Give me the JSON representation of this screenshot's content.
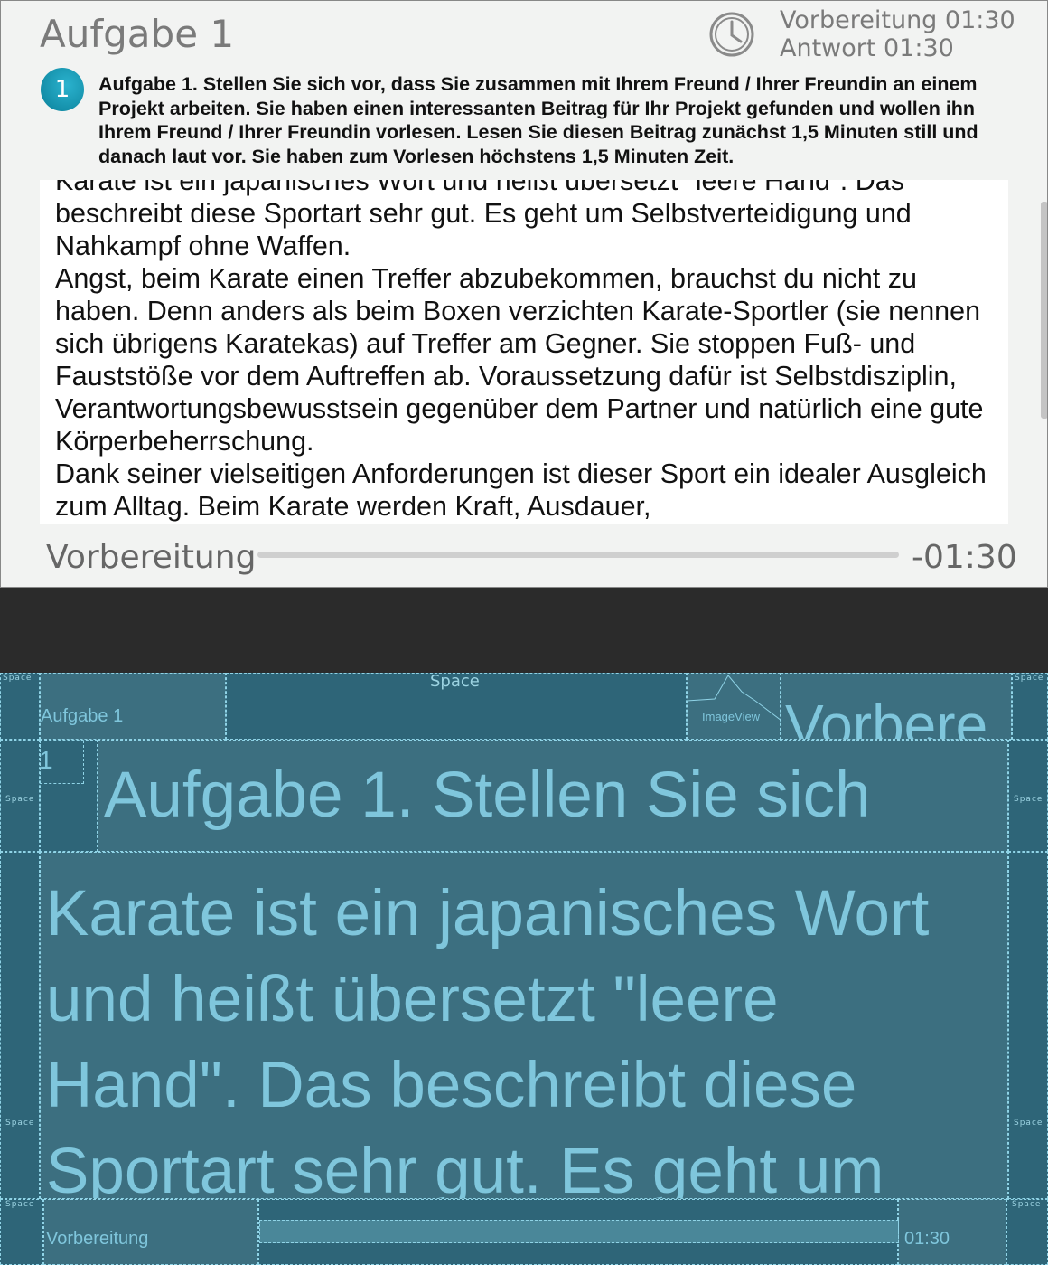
{
  "app": {
    "title": "Aufgabe 1",
    "timers": {
      "preparation": "Vorbereitung 01:30",
      "answer": "Antwort 01:30"
    },
    "badge_number": "1",
    "task_text": "Aufgabe 1. Stellen Sie sich vor, dass Sie zusammen mit Ihrem Freund / Ihrer Freundin an einem Projekt arbeiten. Sie haben einen interessanten Beitrag für Ihr Projekt gefunden und wollen ihn Ihrem Freund / Ihrer Freundin vorlesen. Lesen Sie diesen Beitrag zunächst 1,5 Minuten still und danach laut vor. Sie haben zum Vorlesen höchstens 1,5 Minuten Zeit.",
    "reading_paragraphs": [
      "Karate ist ein japanisches Wort und heißt übersetzt \"leere Hand\". Das beschreibt diese Sportart sehr gut. Es geht um Selbstverteidigung und Nahkampf ohne Waffen.",
      "Angst, beim Karate einen Treffer abzubekommen, brauchst du nicht zu haben. Denn anders als beim Boxen verzichten Karate-Sportler (sie nennen sich übrigens Karatekas) auf Treffer am Gegner. Sie stoppen Fuß- und Fauststöße vor dem Auftreffen ab. Voraussetzung dafür ist Selbstdisziplin, Verantwortungsbewusstsein gegenüber dem Partner und natürlich eine gute Körperbeherrschung.",
      "Dank seiner vielseitigen Anforderungen ist dieser Sport ein idealer Ausgleich zum Alltag. Beim Karate werden Kraft, Ausdauer,"
    ],
    "phase_label": "Vorbereitung",
    "remaining_time": "-01:30",
    "progress_fraction": 0,
    "icons": {
      "clock": "clock-icon"
    },
    "colors": {
      "accent": "#1a9bb8",
      "background": "#f2f3f2"
    }
  },
  "inspector": {
    "space_label": "Space",
    "title": "Aufgabe 1",
    "imageview_label": "ImageView",
    "timer_fragment": "Vorbere",
    "badge": "1",
    "task_fragment": "Aufgabe 1. Stellen Sie sich",
    "reading_lines": [
      "Karate ist ein japanisches Wort",
      "und heißt übersetzt \"leere",
      "Hand\". Das beschreibt diese",
      "Sportart sehr gut. Es geht um"
    ],
    "phase_label": "Vorbereitung",
    "time": "01:30"
  }
}
